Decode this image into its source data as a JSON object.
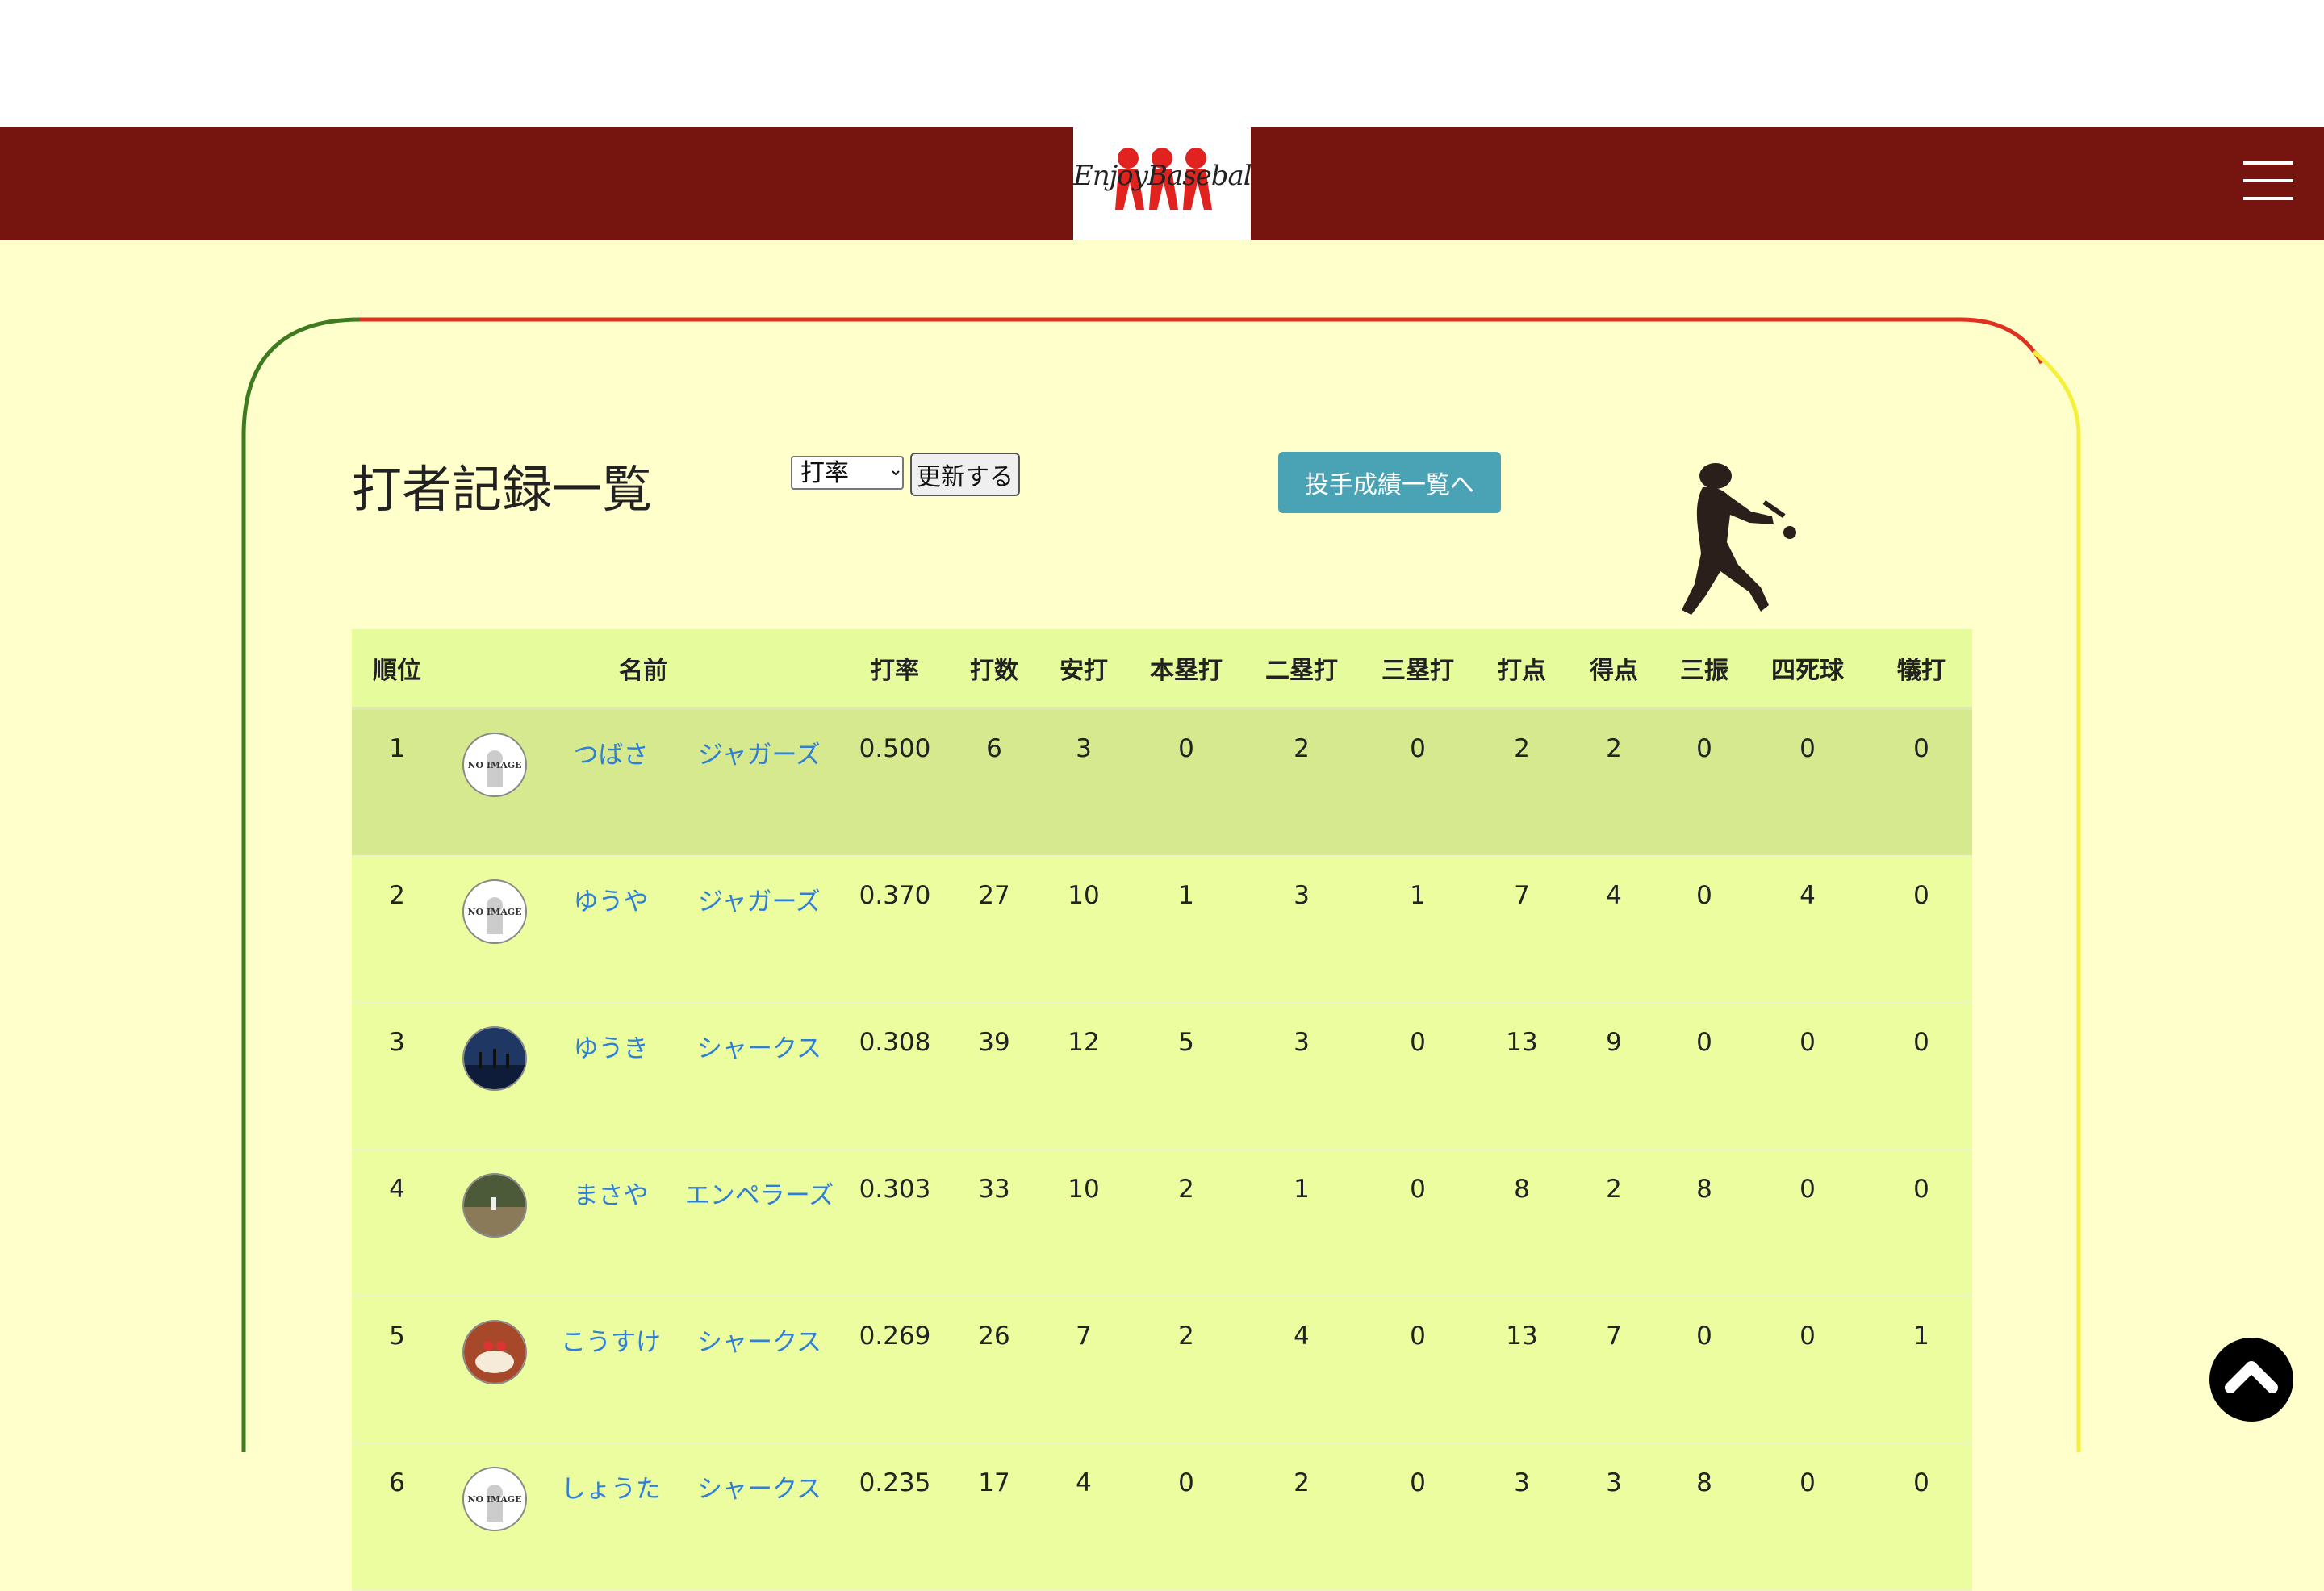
{
  "header": {
    "logo_text": "EnjoyBaseball",
    "menu_icon": "hamburger-icon",
    "brand_color": "#761410"
  },
  "page": {
    "title": "打者記録一覧",
    "sort_selected": "打率",
    "update_label": "更新する",
    "pitcher_link_label": "投手成績一覧へ",
    "batter_icon": "baseball-batter-silhouette-icon",
    "accent_color": "#4aa3b5"
  },
  "table": {
    "headers": [
      "順位",
      "名前",
      "打率",
      "打数",
      "安打",
      "本塁打",
      "二塁打",
      "三塁打",
      "打点",
      "得点",
      "三振",
      "四死球",
      "犠打"
    ],
    "rows": [
      {
        "rank": "1",
        "avatar": "NO IMAGE",
        "name": "つばさ",
        "team": "ジャガーズ",
        "avg": "0.500",
        "ab": "6",
        "hits": "3",
        "hr": "0",
        "d2b": "2",
        "d3b": "0",
        "rbi": "2",
        "runs": "2",
        "so": "0",
        "bb": "0",
        "sac": "0"
      },
      {
        "rank": "2",
        "avatar": "NO IMAGE",
        "name": "ゆうや",
        "team": "ジャガーズ",
        "avg": "0.370",
        "ab": "27",
        "hits": "10",
        "hr": "1",
        "d2b": "3",
        "d3b": "1",
        "rbi": "7",
        "runs": "4",
        "so": "0",
        "bb": "4",
        "sac": "0"
      },
      {
        "rank": "3",
        "avatar": "photo-night",
        "name": "ゆうき",
        "team": "シャークス",
        "avg": "0.308",
        "ab": "39",
        "hits": "12",
        "hr": "5",
        "d2b": "3",
        "d3b": "0",
        "rbi": "13",
        "runs": "9",
        "so": "0",
        "bb": "0",
        "sac": "0"
      },
      {
        "rank": "4",
        "avatar": "photo-field",
        "name": "まさや",
        "team": "エンペラーズ",
        "avg": "0.303",
        "ab": "33",
        "hits": "10",
        "hr": "2",
        "d2b": "1",
        "d3b": "0",
        "rbi": "8",
        "runs": "2",
        "so": "8",
        "bb": "0",
        "sac": "0"
      },
      {
        "rank": "5",
        "avatar": "photo-cake",
        "name": "こうすけ",
        "team": "シャークス",
        "avg": "0.269",
        "ab": "26",
        "hits": "7",
        "hr": "2",
        "d2b": "4",
        "d3b": "0",
        "rbi": "13",
        "runs": "7",
        "so": "0",
        "bb": "0",
        "sac": "1"
      },
      {
        "rank": "6",
        "avatar": "NO IMAGE",
        "name": "しょうた",
        "team": "シャークス",
        "avg": "0.235",
        "ab": "17",
        "hits": "4",
        "hr": "0",
        "d2b": "2",
        "d3b": "0",
        "rbi": "3",
        "runs": "3",
        "so": "8",
        "bb": "0",
        "sac": "0"
      }
    ]
  },
  "scroll_top_icon": "chevron-up-icon"
}
